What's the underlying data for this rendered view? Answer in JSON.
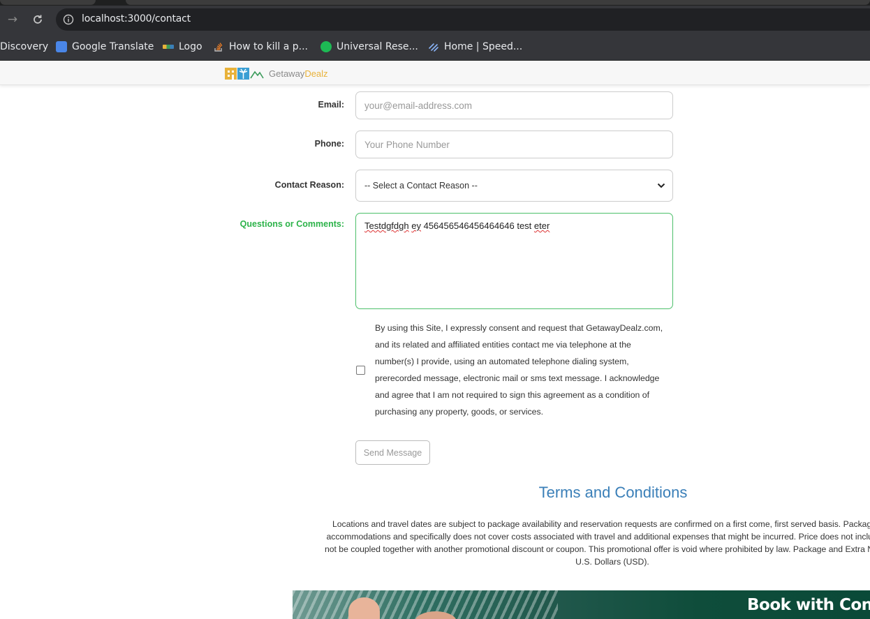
{
  "browser": {
    "url": "localhost:3000/contact",
    "bookmarks": [
      {
        "label": "Discovery",
        "icon": "none"
      },
      {
        "label": "Google Translate",
        "icon": "google-translate-icon"
      },
      {
        "label": "Logo",
        "icon": "logo-bookmark-icon"
      },
      {
        "label": "How to kill a p...",
        "icon": "stackoverflow-icon"
      },
      {
        "label": "Universal Rese...",
        "icon": "universal-icon"
      },
      {
        "label": "Home | Speed...",
        "icon": "speed-icon"
      }
    ]
  },
  "header": {
    "brand_part1": "Getaway",
    "brand_part2": "Dealz",
    "brand_color": "#e8b23a"
  },
  "form": {
    "email_label": "Email:",
    "email_placeholder": "your@email-address.com",
    "phone_label": "Phone:",
    "phone_placeholder": "Your Phone Number",
    "reason_label": "Contact Reason:",
    "reason_selected": "-- Select a Contact Reason --",
    "comments_label": "Questions or Comments:",
    "comments_label_color": "#2db34a",
    "comments_value": {
      "w1": "Testdgfdgh",
      "w2": "ey",
      "w3": "456456546456464646 test ",
      "w4": "eter"
    },
    "consent_text": "By using this Site, I expressly consent and request that GetawayDealz.com, and its related and affiliated entities contact me via telephone at the number(s) I provide, using an automated telephone dialing system, prerecorded message, electronic mail or sms text message. I acknowledge and agree that I am not required to sign this agreement as a condition of purchasing any property, goods, or services.",
    "consent_checked": false,
    "send_label": "Send Message"
  },
  "terms": {
    "title": "Terms and Conditions",
    "line1": "Locations and travel dates are subject to package availability and reservation requests are confirmed on a first come, first served basis. Package pric",
    "line2": "accommodations and specifically does not cover costs associated with travel and additional expenses that might be incurred. Price does not include tax.",
    "line3": "not be coupled together with another promotional discount or coupon. This promotional offer is void where prohibited by law. Package and Extra Night Pri",
    "line4": "U.S. Dollars (USD)."
  },
  "banner": {
    "headline": "Book with Confi"
  }
}
